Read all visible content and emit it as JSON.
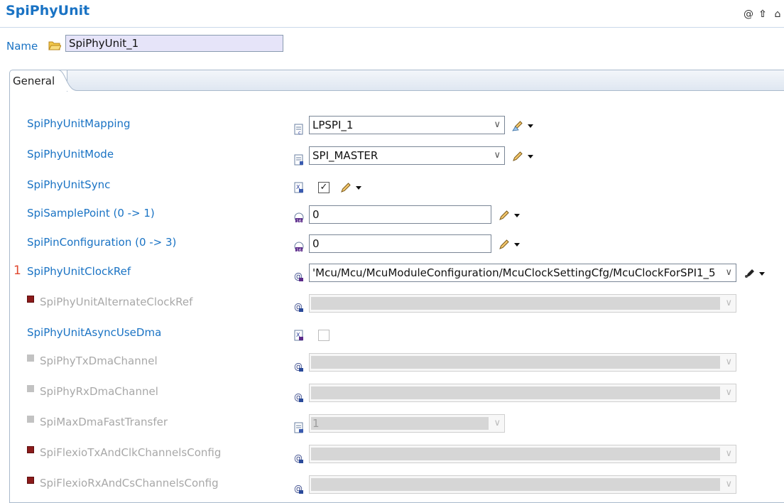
{
  "header": {
    "title": "SpiPhyUnit",
    "icons": [
      "at-icon",
      "up-arrow-icon",
      "home-icon"
    ]
  },
  "name_row": {
    "label": "Name",
    "value": "SpiPhyUnit_1"
  },
  "tabs": [
    {
      "label": "General",
      "active": true
    }
  ],
  "rows": {
    "mapping": {
      "label": "SpiPhyUnitMapping",
      "value": "LPSPI_1"
    },
    "mode": {
      "label": "SpiPhyUnitMode",
      "value": "SPI_MASTER"
    },
    "sync": {
      "label": "SpiPhyUnitSync",
      "checked": true,
      "check_glyph": "✓"
    },
    "sample": {
      "label": "SpiSamplePoint (0 -> 1)",
      "value": "0"
    },
    "pin": {
      "label": "SpiPinConfiguration (0 -> 3)",
      "value": "0"
    },
    "clockref": {
      "label": "SpiPhyUnitClockRef",
      "marker": "1",
      "value": "'Mcu/Mcu/McuModuleConfiguration/McuClockSettingCfg/McuClockForSPI1_5"
    },
    "altclock": {
      "label": "SpiPhyUnitAlternateClockRef",
      "value": ""
    },
    "asyncdma": {
      "label": "SpiPhyUnitAsyncUseDma",
      "checked": false
    },
    "txdma": {
      "label": "SpiPhyTxDmaChannel",
      "value": ""
    },
    "rxdma": {
      "label": "SpiPhyRxDmaChannel",
      "value": ""
    },
    "maxdma": {
      "label": "SpiMaxDmaFastTransfer",
      "value": "1"
    },
    "flexiotx": {
      "label": "SpiFlexioTxAndClkChannelsConfig",
      "value": ""
    },
    "flexiorx": {
      "label": "SpiFlexioRxAndCsChannelsConfig",
      "value": ""
    }
  },
  "glyphs": {
    "chevron": "∨",
    "at": "@",
    "up": "⇧",
    "home": "⌂"
  },
  "colors": {
    "accent": "#1a73c4",
    "name_bg": "#e6e4f9",
    "required_marker": "#e0472e",
    "disabled_text": "#a8a8a8"
  }
}
